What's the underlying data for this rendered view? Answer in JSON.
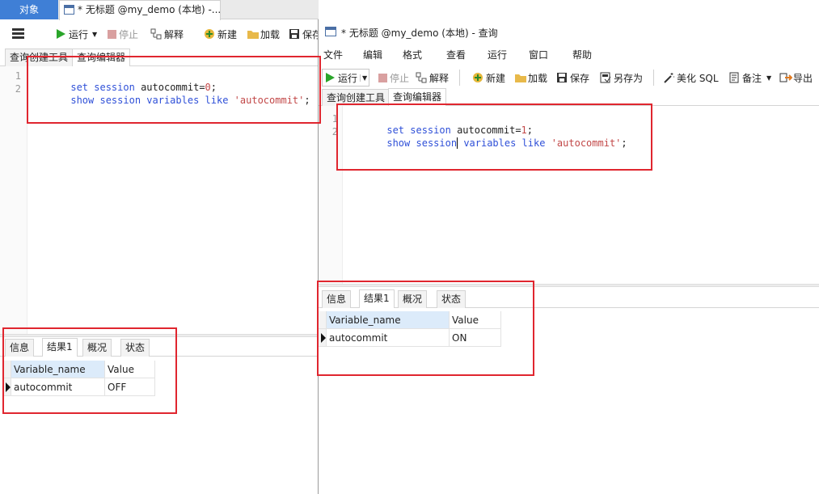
{
  "left": {
    "object_tab": "对象",
    "doc_tab_title": "* 无标题 @my_demo (本地) -...",
    "toolbar": {
      "run": "运行",
      "stop": "停止",
      "explain": "解释",
      "new": "新建",
      "load": "加载",
      "save": "保存"
    },
    "subtabs": [
      "查询创建工具",
      "查询编辑器"
    ],
    "editor": {
      "line_numbers": [
        "1",
        "2"
      ],
      "line1": {
        "kw": "set session",
        "name": " autocommit=",
        "value": "0",
        "end": ";"
      },
      "line2": {
        "kw": "show session variables like",
        "space": " ",
        "str": "'autocommit'",
        "end": ";"
      }
    },
    "result_tabs": [
      "信息",
      "结果1",
      "概况",
      "状态"
    ],
    "grid": {
      "columns": [
        "Variable_name",
        "Value"
      ],
      "rows": [
        [
          "autocommit",
          "OFF"
        ]
      ]
    }
  },
  "right": {
    "window_title": "* 无标题 @my_demo (本地) - 查询",
    "menu": [
      "文件",
      "编辑",
      "格式",
      "查看",
      "运行",
      "窗口",
      "帮助"
    ],
    "toolbar": {
      "run": "运行",
      "stop": "停止",
      "explain": "解释",
      "new": "新建",
      "load": "加载",
      "save": "保存",
      "save_as": "另存为",
      "beautify": "美化 SQL",
      "comment": "备注",
      "export": "导出"
    },
    "subtabs": [
      "查询创建工具",
      "查询编辑器"
    ],
    "editor": {
      "line_numbers": [
        "1",
        "2"
      ],
      "line1": {
        "kw": "set session",
        "name": " autocommit=",
        "value": "1",
        "end": ";"
      },
      "line2": {
        "kw1": "show",
        "kw2": "session",
        "kw3": "variables like",
        "space": " ",
        "str": "'autocommit'",
        "end": ";"
      }
    },
    "result_tabs": [
      "信息",
      "结果1",
      "概况",
      "状态"
    ],
    "grid": {
      "columns": [
        "Variable_name",
        "Value"
      ],
      "rows": [
        [
          "autocommit",
          "ON"
        ]
      ]
    }
  },
  "colors": {
    "highlight": "#e0262f",
    "accent": "#3f7fd6"
  }
}
